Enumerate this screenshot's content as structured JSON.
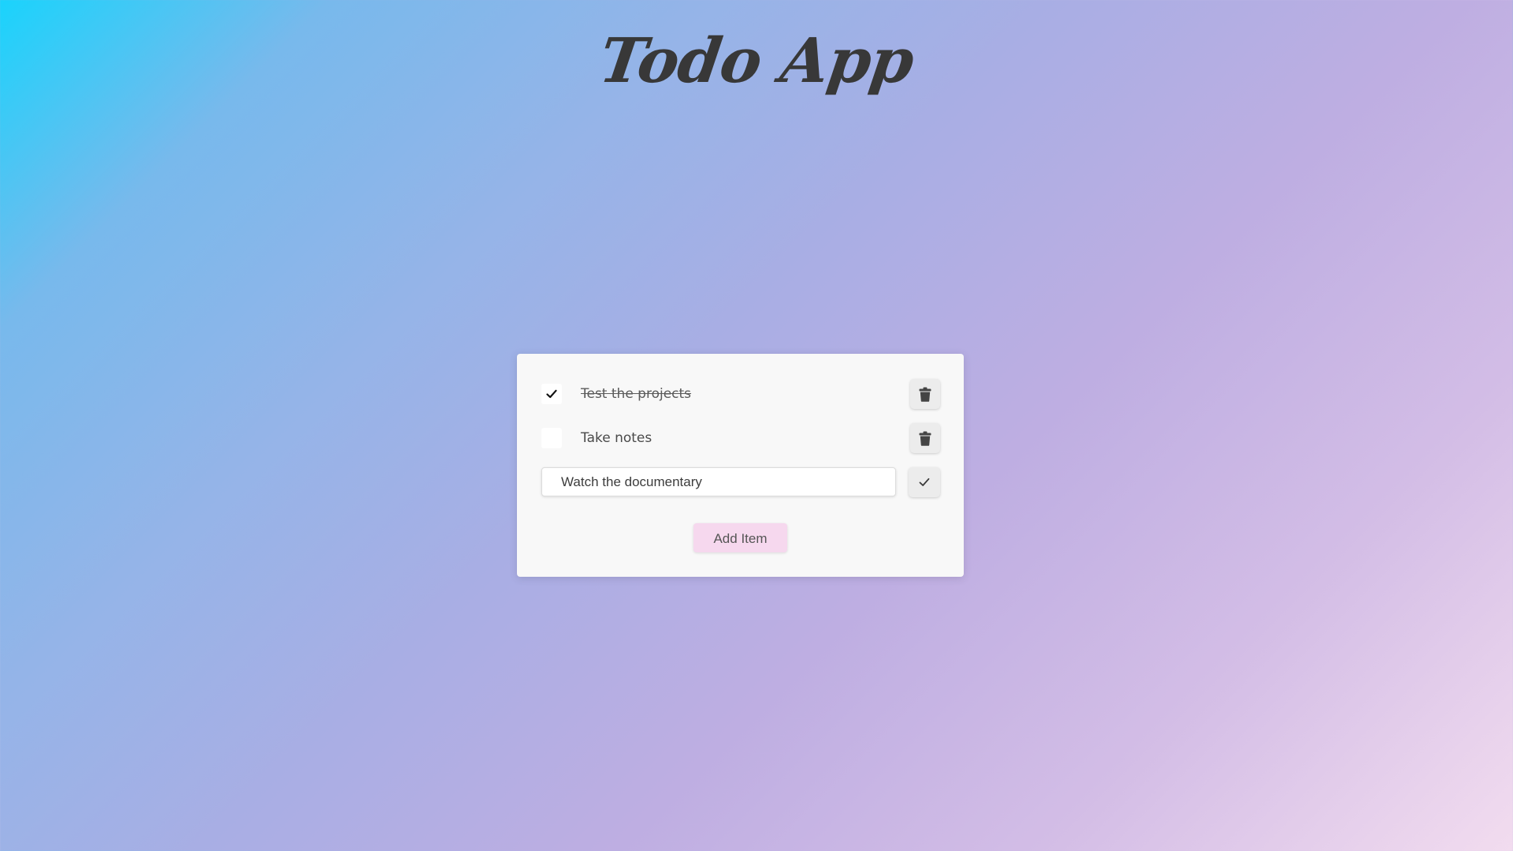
{
  "app": {
    "title": "Todo App"
  },
  "todos": [
    {
      "text": "Test the projects",
      "completed": true,
      "delete_icon": "trash-icon"
    },
    {
      "text": "Take notes",
      "completed": false,
      "delete_icon": "trash-icon"
    }
  ],
  "edit": {
    "value": "Watch the documentary",
    "confirm_icon": "check-icon"
  },
  "add_button": {
    "label": "Add Item"
  },
  "colors": {
    "background_start": "#1ad3fc",
    "background_end": "#f2dcef",
    "title_text": "#383838",
    "card_background": "#f8f8f8",
    "add_button_background": "#f6d8ee"
  }
}
